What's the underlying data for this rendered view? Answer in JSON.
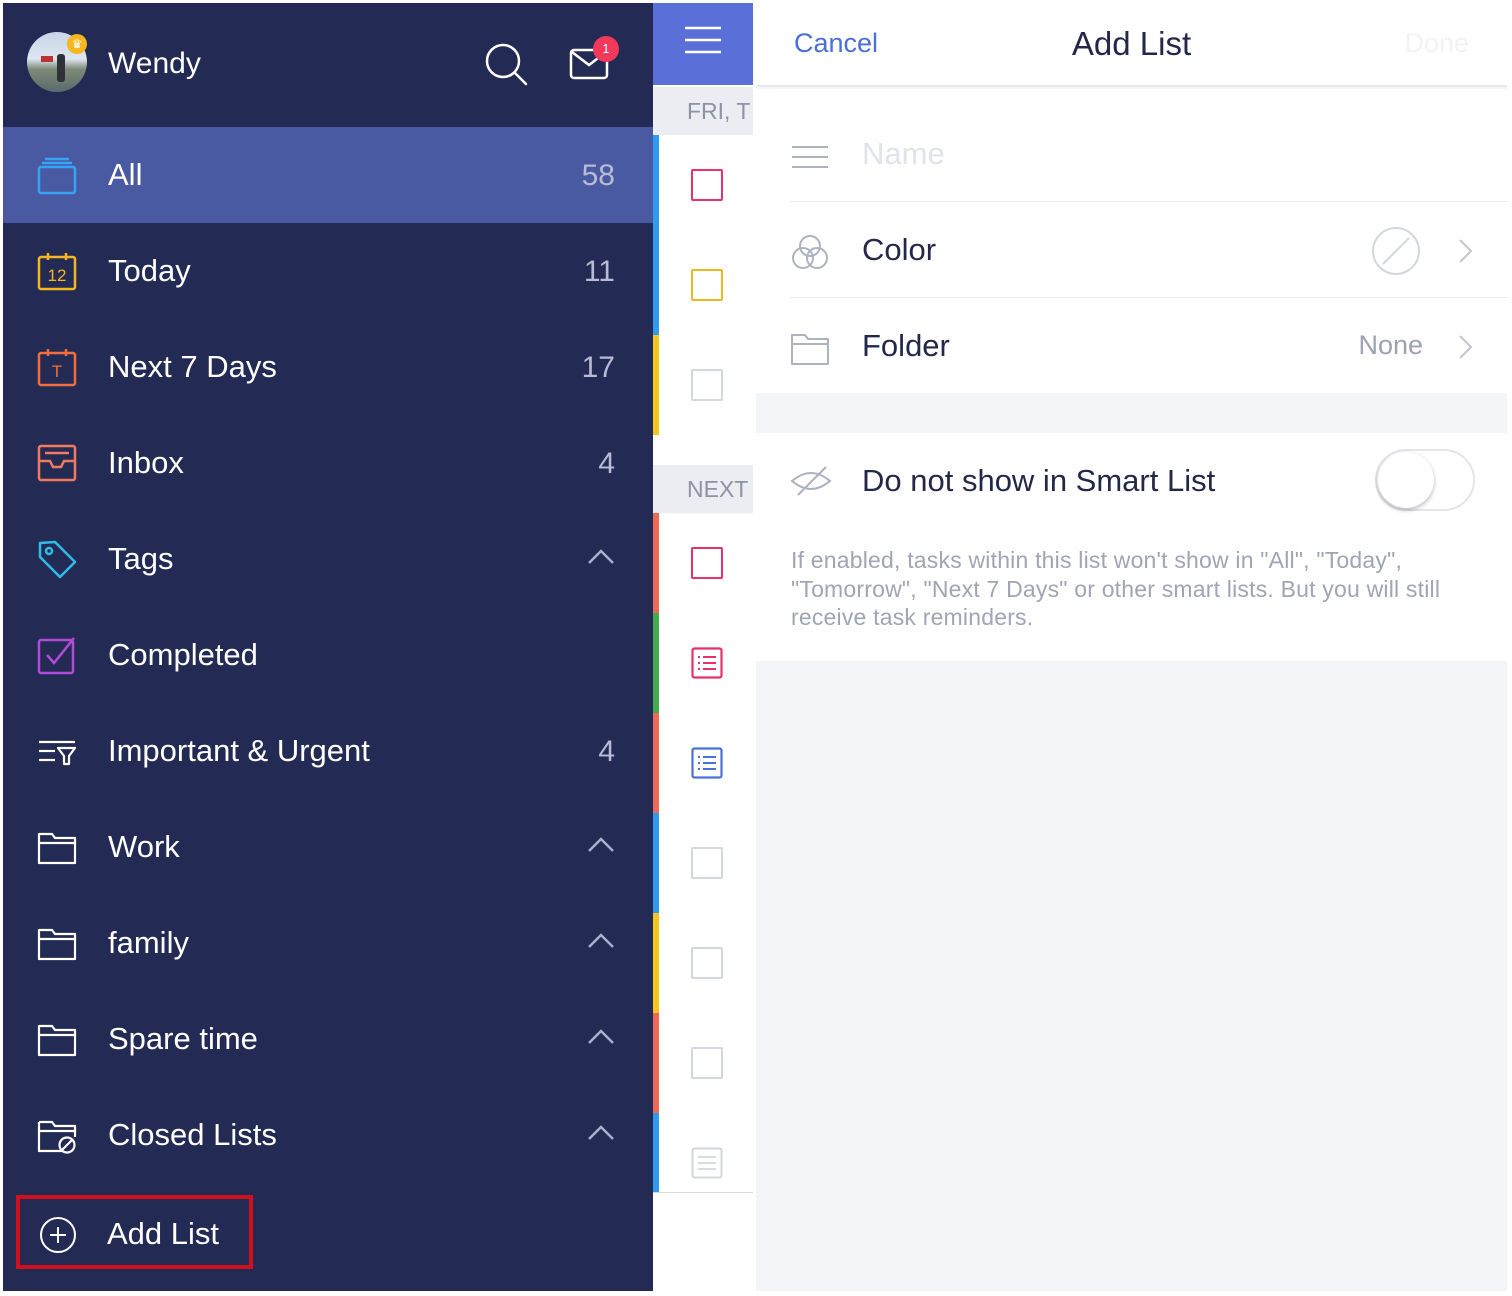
{
  "sidebar": {
    "user": {
      "name": "Wendy"
    },
    "mail_badge": "1",
    "items": [
      {
        "label": "All",
        "count": "58",
        "icon": "stack-icon",
        "active": true
      },
      {
        "label": "Today",
        "count": "11",
        "icon": "calendar-today-icon",
        "day": "12"
      },
      {
        "label": "Next 7 Days",
        "count": "17",
        "icon": "calendar-week-icon",
        "letter": "T"
      },
      {
        "label": "Inbox",
        "count": "4",
        "icon": "inbox-icon"
      },
      {
        "label": "Tags",
        "count": "",
        "icon": "tag-icon",
        "collapsible": true
      },
      {
        "label": "Completed",
        "count": "",
        "icon": "checked-box-icon"
      },
      {
        "label": "Important & Urgent",
        "count": "4",
        "icon": "filter-icon"
      },
      {
        "label": "Work",
        "count": "",
        "icon": "folder-icon",
        "collapsible": true
      },
      {
        "label": "family",
        "count": "",
        "icon": "folder-icon",
        "collapsible": true
      },
      {
        "label": "Spare time",
        "count": "",
        "icon": "folder-icon",
        "collapsible": true
      },
      {
        "label": "Closed Lists",
        "count": "",
        "icon": "closed-folder-icon",
        "collapsible": true
      }
    ],
    "add_list_label": "Add List"
  },
  "task_strip": {
    "sections": [
      "FRI, T",
      "NEXT"
    ]
  },
  "panel": {
    "cancel_label": "Cancel",
    "title": "Add List",
    "done_label": "Done",
    "name_placeholder": "Name",
    "color_label": "Color",
    "folder_label": "Folder",
    "folder_value": "None",
    "smart_list_label": "Do not show in Smart List",
    "smart_list_enabled": false,
    "help_text": "If enabled, tasks within this list won't show in \"All\", \"Today\", \"Tomorrow\", \"Next 7 Days\" or other smart lists. But you will still receive task reminders."
  },
  "colors": {
    "sidebar_bg": "#232a54",
    "sidebar_active": "#4a5aa2",
    "accent": "#4a6fd6",
    "highlight_border": "#d0111c"
  }
}
